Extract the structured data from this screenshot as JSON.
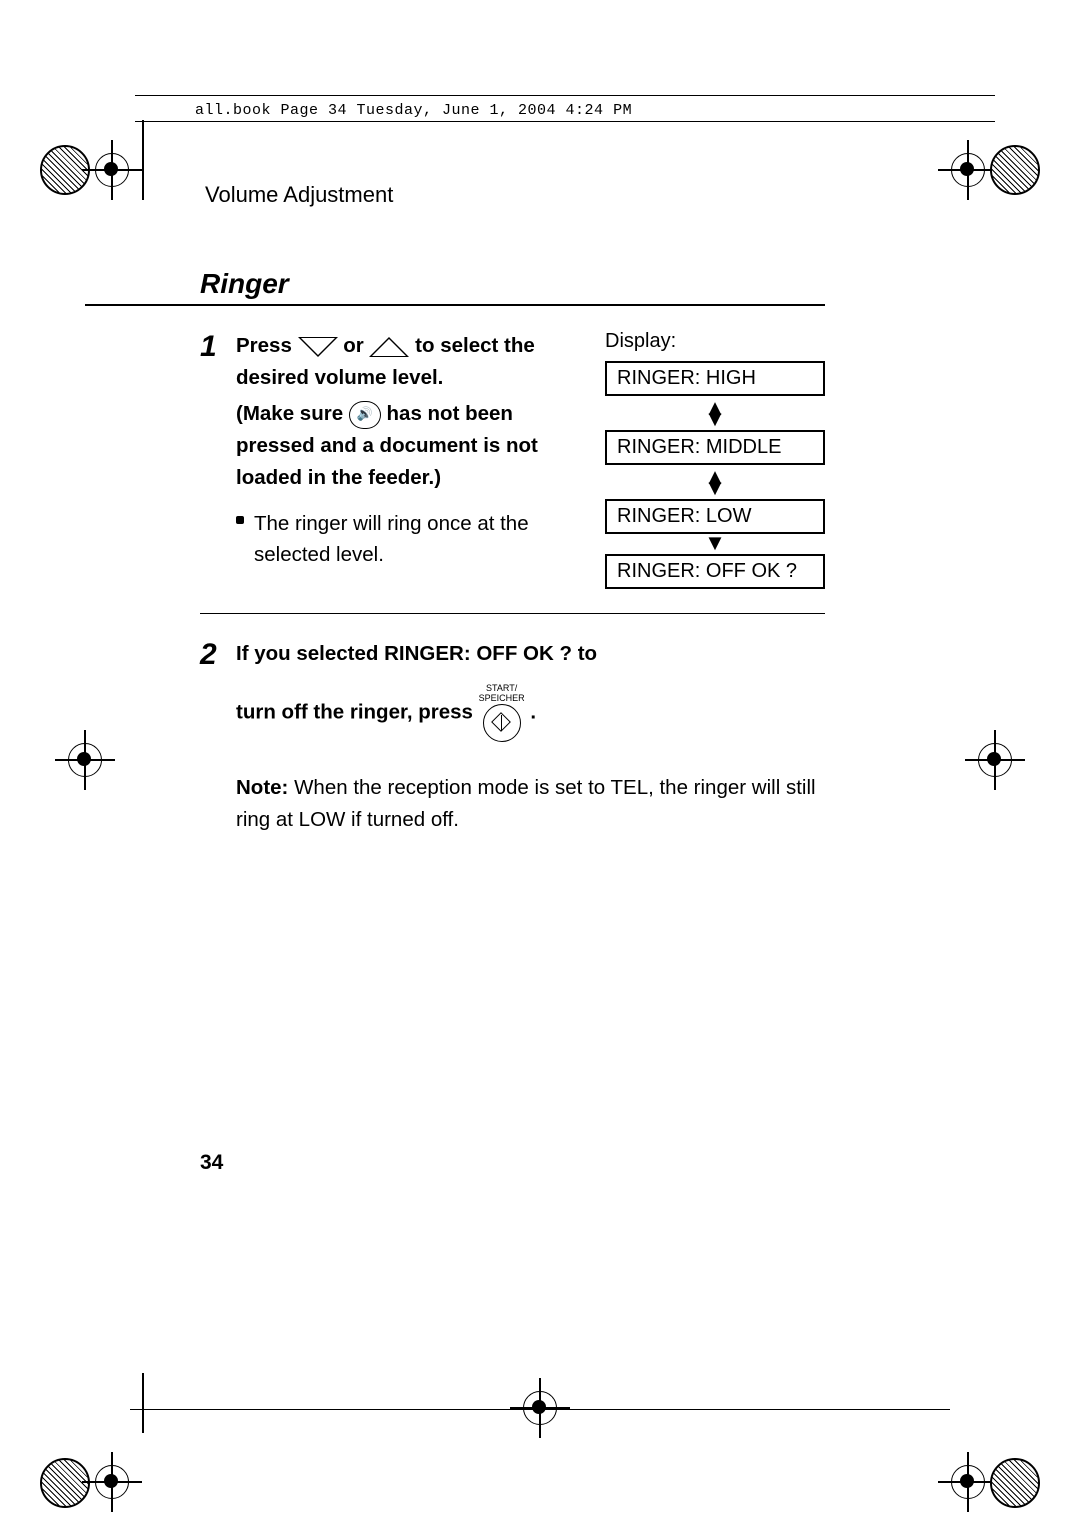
{
  "header_text": "all.book  Page 34  Tuesday, June 1, 2004  4:24 PM",
  "section_title": "Volume Adjustment",
  "ringer_title": "Ringer",
  "step1": {
    "num": "1",
    "press": "Press ",
    "or": " or ",
    "to_select": " to select the desired volume level.",
    "make_sure": "(Make sure ",
    "not_pressed": " has not been pressed and a document is not loaded in the feeder.)",
    "bullet": "The ringer will ring once at the selected level.",
    "display_label": "Display:",
    "display": {
      "high": "RINGER: HIGH",
      "middle": "RINGER: MIDDLE",
      "low": "RINGER: LOW",
      "off": "RINGER: OFF OK ?"
    }
  },
  "step2": {
    "num": "2",
    "line1": "If you selected RINGER: OFF OK ? to",
    "line2_a": "turn off the ringer, press ",
    "line2_b": " .",
    "start_label_1": "START/",
    "start_label_2": "SPEICHER",
    "note_bold": "Note:",
    "note_rest": " When the reception mode is set to TEL, the ringer will still ring at LOW if turned off."
  },
  "page_num": "34",
  "icons": {
    "speaker": "🔊"
  }
}
